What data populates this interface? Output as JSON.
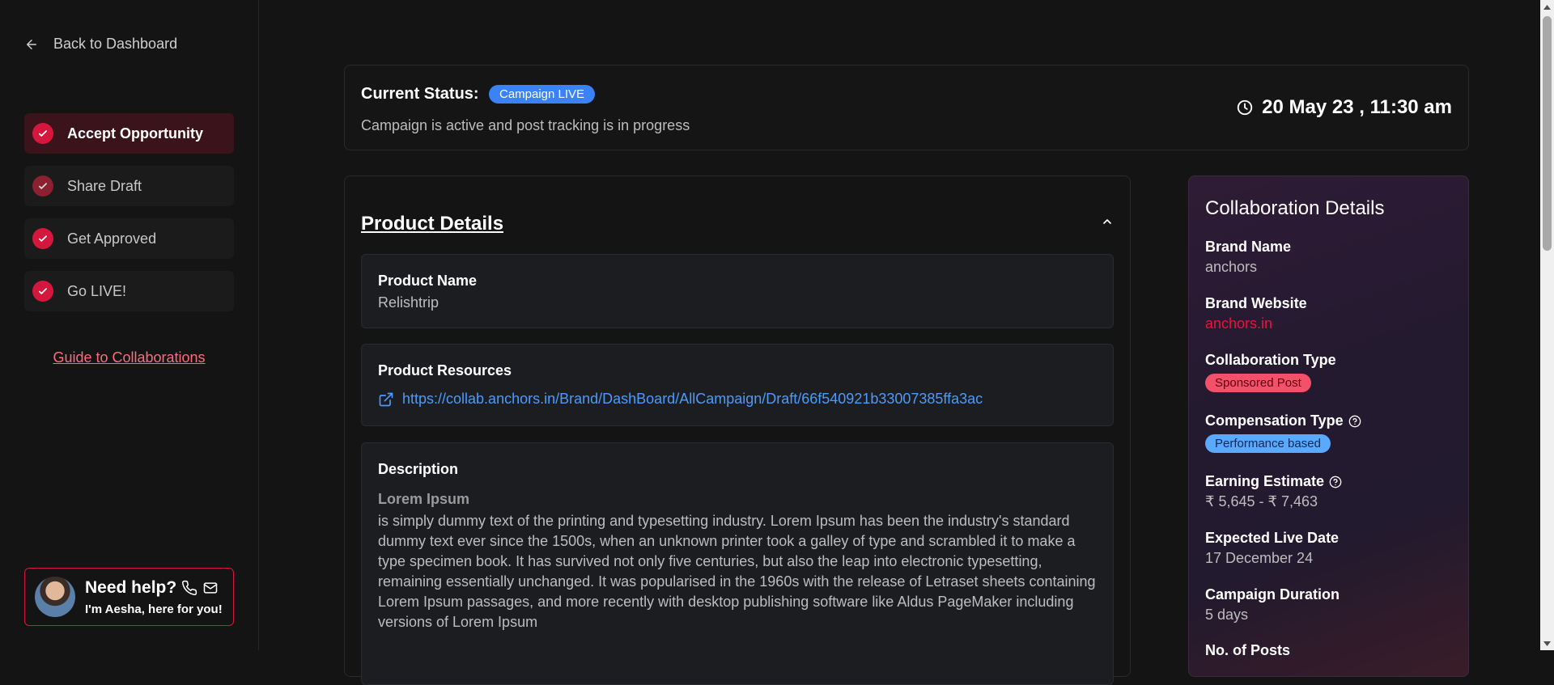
{
  "sidebar": {
    "back_label": "Back to Dashboard",
    "steps": [
      {
        "label": "Accept Opportunity"
      },
      {
        "label": "Share Draft"
      },
      {
        "label": "Get Approved"
      },
      {
        "label": "Go LIVE!"
      }
    ],
    "guide_label": "Guide to Collaborations",
    "help": {
      "title": "Need help?",
      "subtitle": "I'm Aesha, here for you!"
    }
  },
  "status": {
    "label": "Current Status:",
    "badge": "Campaign LIVE",
    "description": "Campaign is active and post tracking is in progress",
    "datetime": "20 May 23 , 11:30 am"
  },
  "product": {
    "title": "Product Details",
    "name_label": "Product Name",
    "name_value": "Relishtrip",
    "resources_label": "Product Resources",
    "resource_url": "https://collab.anchors.in/Brand/DashBoard/AllCampaign/Draft/66f540921b33007385ffa3ac",
    "description_label": "Description",
    "description_title": "Lorem Ipsum",
    "description_body": "is simply dummy text of the printing and typesetting industry. Lorem Ipsum has been the industry's standard dummy text ever since the 1500s, when an unknown printer took a galley of type and scrambled it to make a type specimen book. It has survived not only five centuries, but also the leap into electronic typesetting, remaining essentially unchanged. It was popularised in the 1960s with the release of Letraset sheets containing Lorem Ipsum passages, and more recently with desktop publishing software like Aldus PageMaker including versions of Lorem Ipsum"
  },
  "collab": {
    "title": "Collaboration Details",
    "brand_name_label": "Brand Name",
    "brand_name": "anchors",
    "brand_website_label": "Brand Website",
    "brand_website": "anchors.in",
    "collab_type_label": "Collaboration Type",
    "collab_type": "Sponsored Post",
    "comp_type_label": "Compensation Type",
    "comp_type": "Performance based",
    "earning_label": "Earning Estimate",
    "earning": "₹ 5,645 - ₹ 7,463",
    "live_date_label": "Expected Live Date",
    "live_date": "17 December 24",
    "duration_label": "Campaign Duration",
    "duration": "5 days",
    "posts_label": "No. of Posts"
  },
  "colors": {
    "accent": "#d6173d",
    "link": "#4a9bff",
    "live_badge": "#3b82f6"
  }
}
